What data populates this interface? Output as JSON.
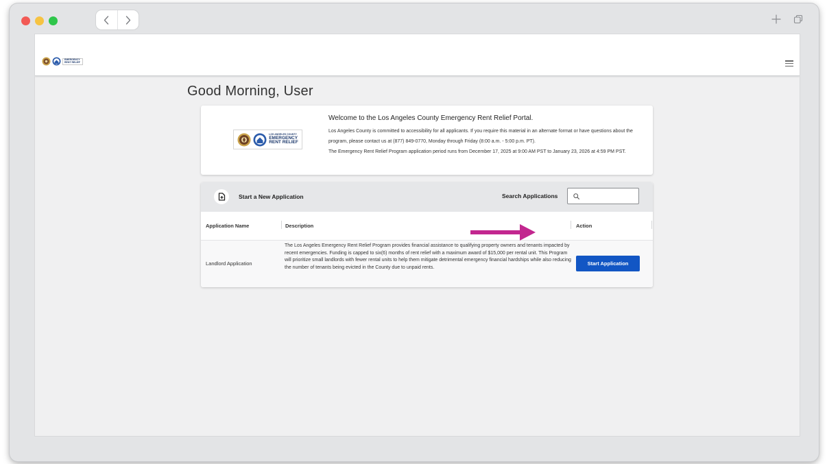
{
  "browser": {
    "traffic_lights": [
      "close",
      "minimize",
      "zoom"
    ],
    "icons": [
      "back-icon",
      "forward-icon",
      "new-tab-icon",
      "tab-overview-icon"
    ]
  },
  "app": {
    "menu_icon": "hamburger-menu-icon",
    "logo_line1": "LOS ANGELES COUNTY",
    "logo_line2": "EMERGENCY",
    "logo_line3": "RENT RELIEF"
  },
  "greeting": "Good Morning, User",
  "welcome": {
    "title": "Welcome to the Los Angeles County Emergency Rent Relief Portal.",
    "accessibility": "Los Angeles County is committed to accessibility for all applicants. If you require this material in an alternate format or have questions about the program, please contact us at (877) 849-0770, Monday through Friday (8:00 a.m. - 5:00 p.m. PT).",
    "period": "The Emergency Rent Relief Program application period runs from December 17, 2025 at 9:00 AM PST to January 23, 2026 at 4:59 PM PST."
  },
  "applications": {
    "new_label": "Start a New Application",
    "search_label": "Search Applications",
    "search_placeholder": "",
    "columns": {
      "name": "Application Name",
      "description": "Description",
      "action": "Action"
    },
    "rows": [
      {
        "name": "Landlord Application",
        "description": "The Los Angeles Emergency Rent Relief Program provides financial assistance to qualifying property owners and tenants impacted by recent emergencies. Funding is capped to six(6) months of rent relief with a maximum award of $15,000 per rental unit. This Program will prioritize small landlords with fewer rental units to help them mitigate detrimental emergency financial hardships while also reducing the number of tenants being evicted in the County due to unpaid rents.",
        "action_label": "Start Application"
      }
    ]
  },
  "colors": {
    "primary_button": "#1256c4",
    "annotation_arrow": "#c2278f"
  }
}
